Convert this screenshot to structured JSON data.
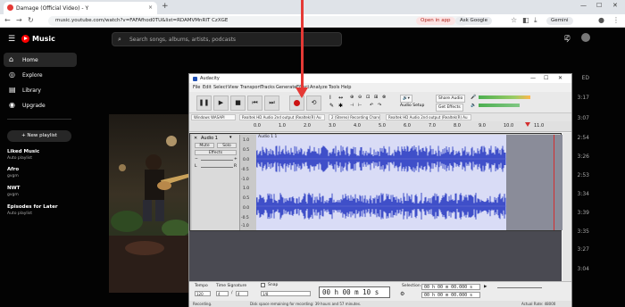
{
  "browser": {
    "tab_title": "Damage (Official Video) - Y",
    "tab_close": "×",
    "new_tab": "+",
    "url": "music.youtube.com/watch?v=FAFAfhod0TU&list=RDAMVMnRIT CzXGE",
    "open_in_app": "Open in app",
    "ask_google": "Ask Google",
    "gemini": "Gemini"
  },
  "ytmusic": {
    "brand": "Music",
    "search_placeholder": "Search songs, albums, artists, podcasts",
    "nav": [
      {
        "label": "Home",
        "icon": "home-icon"
      },
      {
        "label": "Explore",
        "icon": "compass-icon"
      },
      {
        "label": "Library",
        "icon": "library-icon"
      },
      {
        "label": "Upgrade",
        "icon": "upgrade-icon"
      }
    ],
    "new_playlist": "+ New playlist",
    "playlists": [
      {
        "title": "Liked Music",
        "subtitle": "Auto playlist"
      },
      {
        "title": "Afro",
        "subtitle": "gvgm"
      },
      {
        "title": "NWT",
        "subtitle": "gvgm"
      },
      {
        "title": "Episodes for Later",
        "subtitle": "Auto playlist"
      }
    ],
    "durations": [
      "3:17",
      "3:07",
      "2:54",
      "3:26",
      "2:53",
      "3:34",
      "3:39",
      "3:35",
      "3:27",
      "3:04"
    ],
    "partial_text": "ED"
  },
  "audacity": {
    "title": "Audacity",
    "menu": [
      "File",
      "Edit",
      "Select",
      "View",
      "Transport",
      "Tracks",
      "Generate",
      "Effect",
      "Analyze",
      "Tools",
      "Help"
    ],
    "audio_setup": "Audio Setup",
    "share_audio": "Share Audio",
    "get_effects": "Get Effects",
    "devices": {
      "host": "Windows WASAPI",
      "output_loop": "Realtek HD Audio 2nd output (Realtek(R) Au",
      "channels": "2 (Stereo) Recording Chann",
      "output": "Realtek HD Audio 2nd output (Realtek(R) Au"
    },
    "ruler_ticks": [
      "0.0",
      "1.0",
      "2.0",
      "3.0",
      "4.0",
      "5.0",
      "6.0",
      "7.0",
      "8.0",
      "9.0",
      "10.0",
      "11.0"
    ],
    "track": {
      "name": "Audio 1",
      "clip_name": "Audio 1 1",
      "mute": "Mute",
      "solo": "Solo",
      "effects": "Effects",
      "gain_l": "L",
      "gain_r": "R",
      "scale": [
        "1.0",
        "0.5",
        "0.0",
        "-0.5",
        "-1.0",
        "1.0",
        "0.5",
        "0.0",
        "-0.5",
        "-1.0"
      ]
    },
    "bottom": {
      "tempo_label": "Tempo",
      "tempo": "120",
      "time_sig_label": "Time Signature",
      "time_sig_num": "4",
      "time_sig_den": "4",
      "snap_label": "Snap",
      "snap_value": "1/8",
      "time_display": "00 h 00 m 10 s",
      "selection_label": "Selection",
      "sel_start": "00 h 00 m 00.000 s",
      "sel_end": "00 h 00 m 00.000 s"
    },
    "status": {
      "left": "Recording.",
      "middle": "Disk space remaining for recording: 39 hours and 57 minutes.",
      "right": "Actual Rate: 48000"
    }
  }
}
